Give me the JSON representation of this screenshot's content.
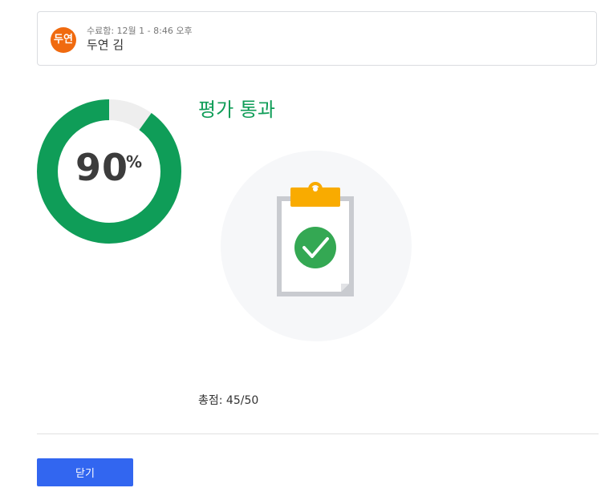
{
  "submission": {
    "avatar_initials": "두연",
    "submitted_text": "수료함: 12월 1 - 8:46 오후",
    "student_name": "두연 김"
  },
  "score": {
    "percent_value": 90,
    "percent_display": "90",
    "percent_sign": "%",
    "result_title": "평가 통과",
    "total_label": "총점: 45/50"
  },
  "actions": {
    "close_label": "닫기"
  },
  "illustration": {
    "icon": "clipboard-check-icon"
  },
  "colors": {
    "avatar": "#f06a0f",
    "donut_fill": "#0f9d58",
    "donut_track": "#eeeeee",
    "result_title": "#0f9d58",
    "check_circle": "#34a853",
    "clipboard_clip": "#f9ab00",
    "close_button": "#3266f0"
  }
}
